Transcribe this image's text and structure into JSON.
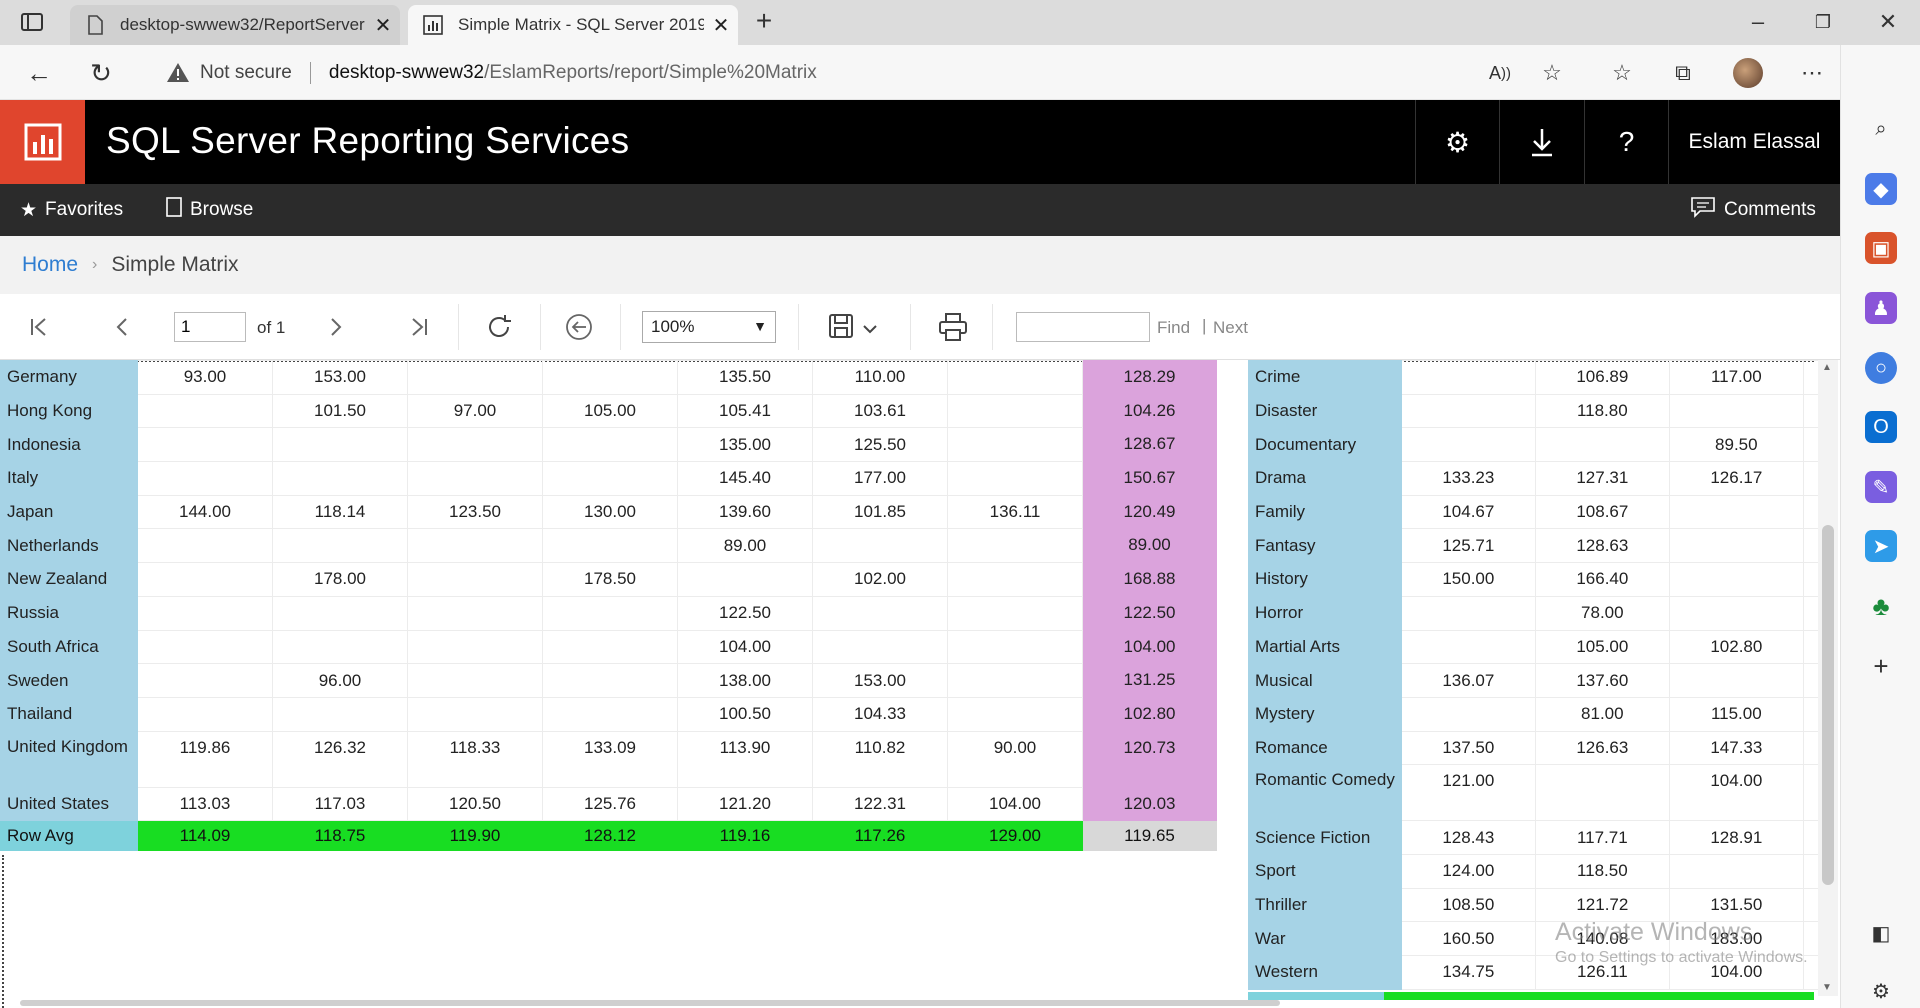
{
  "browser": {
    "tabs": [
      {
        "title": "desktop-swwew32/ReportServer",
        "active": false
      },
      {
        "title": "Simple Matrix - SQL Server 2019",
        "active": true
      }
    ],
    "address": {
      "security_label": "Not secure",
      "host": "desktop-swwew32",
      "path": "/EslamReports/report/Simple%20Matrix"
    }
  },
  "ssrs": {
    "title": "SQL Server Reporting Services",
    "user": "Eslam Elassal",
    "nav": {
      "favorites": "Favorites",
      "browse": "Browse",
      "comments": "Comments"
    },
    "breadcrumb": {
      "home": "Home",
      "current": "Simple Matrix"
    }
  },
  "toolbar": {
    "page_value": "1",
    "page_of": "of 1",
    "zoom": "100%",
    "find_label": "Find",
    "next_sep": "|",
    "next_label": "Next"
  },
  "country_table": {
    "rows": [
      {
        "label": "Germany",
        "cells": [
          "93.00",
          "153.00",
          "",
          "",
          "135.50",
          "110.00",
          ""
        ],
        "avg": "128.29"
      },
      {
        "label": "Hong Kong",
        "cells": [
          "",
          "101.50",
          "97.00",
          "105.00",
          "105.41",
          "103.61",
          ""
        ],
        "avg": "104.26"
      },
      {
        "label": "Indonesia",
        "cells": [
          "",
          "",
          "",
          "",
          "135.00",
          "125.50",
          ""
        ],
        "avg": "128.67"
      },
      {
        "label": "Italy",
        "cells": [
          "",
          "",
          "",
          "",
          "145.40",
          "177.00",
          ""
        ],
        "avg": "150.67"
      },
      {
        "label": "Japan",
        "cells": [
          "144.00",
          "118.14",
          "123.50",
          "130.00",
          "139.60",
          "101.85",
          "136.11"
        ],
        "avg": "120.49"
      },
      {
        "label": "Netherlands",
        "cells": [
          "",
          "",
          "",
          "",
          "89.00",
          "",
          ""
        ],
        "avg": "89.00"
      },
      {
        "label": "New Zealand",
        "cells": [
          "",
          "178.00",
          "",
          "178.50",
          "",
          "102.00",
          ""
        ],
        "avg": "168.88"
      },
      {
        "label": "Russia",
        "cells": [
          "",
          "",
          "",
          "",
          "122.50",
          "",
          ""
        ],
        "avg": "122.50"
      },
      {
        "label": "South Africa",
        "cells": [
          "",
          "",
          "",
          "",
          "104.00",
          "",
          ""
        ],
        "avg": "104.00"
      },
      {
        "label": "Sweden",
        "cells": [
          "",
          "96.00",
          "",
          "",
          "138.00",
          "153.00",
          ""
        ],
        "avg": "131.25"
      },
      {
        "label": "Thailand",
        "cells": [
          "",
          "",
          "",
          "",
          "100.50",
          "104.33",
          ""
        ],
        "avg": "102.80"
      },
      {
        "label": "United Kingdom",
        "cells": [
          "119.86",
          "126.32",
          "118.33",
          "133.09",
          "113.90",
          "110.82",
          "90.00"
        ],
        "avg": "120.73"
      },
      {
        "label": "United States",
        "cells": [
          "113.03",
          "117.03",
          "120.50",
          "125.76",
          "121.20",
          "122.31",
          "104.00"
        ],
        "avg": "120.03"
      }
    ],
    "footer": {
      "label": "Row Avg",
      "cells": [
        "114.09",
        "118.75",
        "119.90",
        "128.12",
        "119.16",
        "117.26",
        "129.00"
      ],
      "avg": "119.65"
    }
  },
  "genre_table": {
    "rows": [
      {
        "label": "Crime",
        "cells": [
          "",
          "106.89",
          "117.00"
        ]
      },
      {
        "label": "Disaster",
        "cells": [
          "",
          "118.80",
          ""
        ]
      },
      {
        "label": "Documentary",
        "cells": [
          "",
          "",
          "89.50"
        ]
      },
      {
        "label": "Drama",
        "cells": [
          "133.23",
          "127.31",
          "126.17"
        ]
      },
      {
        "label": "Family",
        "cells": [
          "104.67",
          "108.67",
          ""
        ]
      },
      {
        "label": "Fantasy",
        "cells": [
          "125.71",
          "128.63",
          ""
        ]
      },
      {
        "label": "History",
        "cells": [
          "150.00",
          "166.40",
          ""
        ]
      },
      {
        "label": "Horror",
        "cells": [
          "",
          "78.00",
          ""
        ]
      },
      {
        "label": "Martial Arts",
        "cells": [
          "",
          "105.00",
          "102.80"
        ]
      },
      {
        "label": "Musical",
        "cells": [
          "136.07",
          "137.60",
          ""
        ]
      },
      {
        "label": "Mystery",
        "cells": [
          "",
          "81.00",
          "115.00"
        ]
      },
      {
        "label": "Romance",
        "cells": [
          "137.50",
          "126.63",
          "147.33"
        ]
      },
      {
        "label": "Romantic Comedy",
        "cells": [
          "121.00",
          "",
          "104.00"
        ]
      },
      {
        "label": "Science Fiction",
        "cells": [
          "128.43",
          "117.71",
          "128.91"
        ]
      },
      {
        "label": "Sport",
        "cells": [
          "124.00",
          "118.50",
          ""
        ]
      },
      {
        "label": "Thriller",
        "cells": [
          "108.50",
          "121.72",
          "131.50"
        ]
      },
      {
        "label": "War",
        "cells": [
          "160.50",
          "140.08",
          "183.00"
        ]
      },
      {
        "label": "Western",
        "cells": [
          "134.75",
          "126.11",
          "104.00"
        ]
      }
    ]
  },
  "watermark": {
    "line1": "Activate Windows",
    "line2": "Go to Settings to activate Windows."
  },
  "colors": {
    "ssrs_red": "#e0452d",
    "row_header_blue": "#a6d3e6",
    "avg_pink": "#dba3dc",
    "footer_green": "#18dd22",
    "footer_teal": "#7ed2dc",
    "link_blue": "#2e7dd1"
  }
}
